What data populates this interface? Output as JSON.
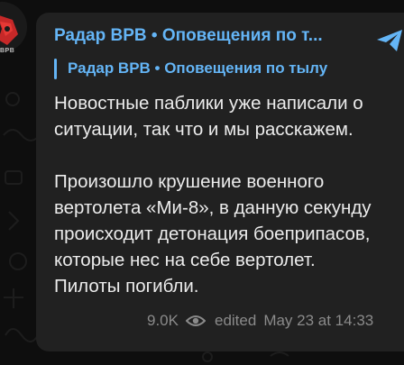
{
  "channel": {
    "avatar_icon": "helicopter-crest-icon",
    "avatar_caption": "ВРВ"
  },
  "message": {
    "forward_title": "Радар ВРВ • Оповещения по т...",
    "reply_to": "Радар ВРВ • Оповещения по тылу",
    "paragraphs": [
      [
        "Новостные паблики уже написали о",
        "ситуации, так что и мы расскажем."
      ],
      [
        "Произошло крушение военного",
        "вертолета «Ми-8», в данную секунду",
        "происходит детонация боеприпасов,",
        "которые нес на себе вертолет.",
        "Пилоты погибли."
      ]
    ],
    "views": "9.0K",
    "views_icon": "eye-icon",
    "edited_label": "edited",
    "timestamp": "May 23 at 14:33",
    "share_icon": "share-arrow-icon"
  },
  "colors": {
    "background": "#0e0e0e",
    "bubble": "#212121",
    "accent": "#64b5f6",
    "text": "#ececec",
    "meta": "#8a8a8a"
  }
}
